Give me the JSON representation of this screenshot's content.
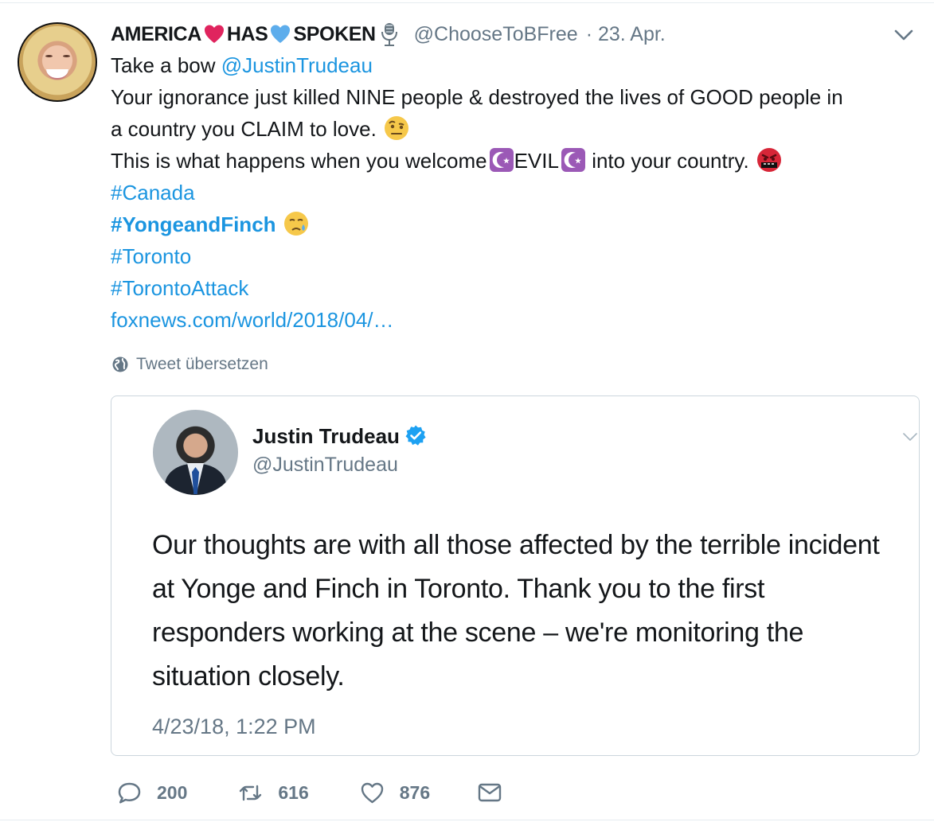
{
  "tweet": {
    "author": {
      "display_name_parts": [
        "AMERICA",
        "HAS",
        "SPOKEN"
      ],
      "handle": "@ChooseToBFree",
      "date": "· 23. Apr.",
      "avatar_alt": "profile photo of the author"
    },
    "body": {
      "line1_prefix": "Take a bow ",
      "line1_mention": "@JustinTrudeau",
      "line2": "Your ignorance just killed NINE people & destroyed the lives of GOOD people in",
      "line3": "a country you CLAIM to love.",
      "line4_before": "This is what happens when you welcome",
      "line4_evil": "EVIL",
      "line4_after": " into your country.",
      "hashtag1": "#Canada",
      "hashtag2": "#YongeandFinch",
      "hashtag3": "#Toronto",
      "hashtag4": "#TorontoAttack",
      "link": "foxnews.com/world/2018/04/…"
    },
    "translate_label": "Tweet übersetzen",
    "quoted": {
      "name": "Justin Trudeau",
      "handle": "@JustinTrudeau",
      "text": "Our thoughts are with all those affected by the terrible incident at Yonge and Finch in Toronto. Thank you to the first responders working at the scene – we're monitoring the situation closely.",
      "date": "4/23/18, 1:22 PM"
    },
    "actions": {
      "replies": "200",
      "retweets": "616",
      "likes": "876"
    },
    "icons": {
      "heart_red": "red-heart-emoji",
      "heart_blue": "blue-heart-emoji",
      "microphone": "studio-microphone-emoji",
      "face": "face-with-raised-eyebrow-emoji",
      "star_crescent": "star-and-crescent-emoji",
      "symbols_face": "face-with-symbols-emoji",
      "sad_face": "sad-relieved-face-emoji",
      "globe": "globe-icon",
      "verified": "verified-badge-icon",
      "reply": "reply-icon",
      "retweet": "retweet-icon",
      "like": "like-icon",
      "message": "direct-message-icon"
    },
    "colors": {
      "link": "#1b95e0",
      "muted": "#657786",
      "text": "#14171a",
      "border": "#ccd6dd"
    }
  }
}
